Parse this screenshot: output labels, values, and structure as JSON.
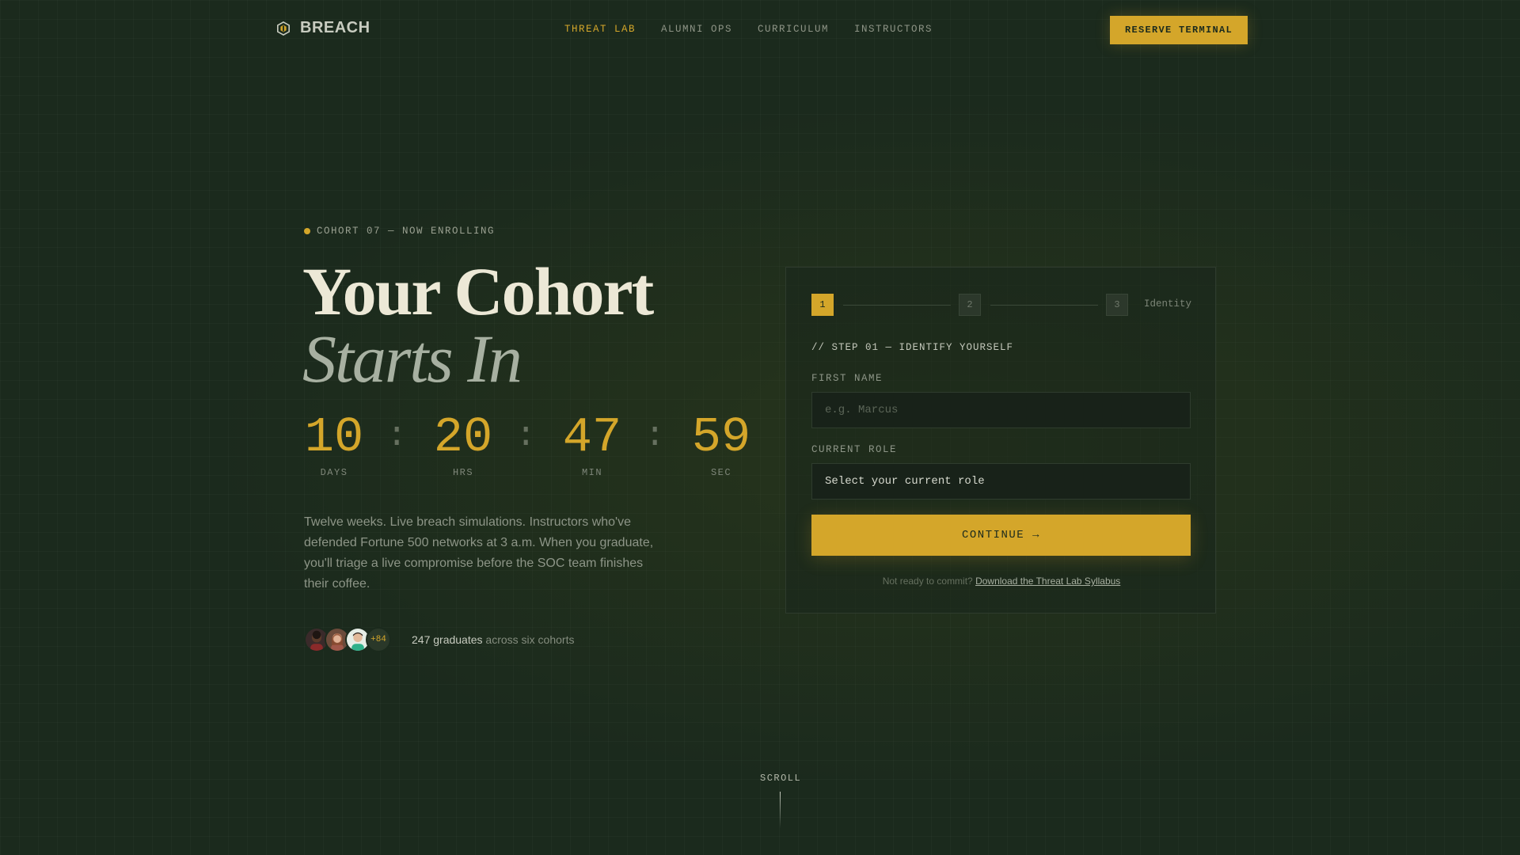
{
  "nav": {
    "brand": "BREACH",
    "links": [
      {
        "label": "THREAT LAB",
        "active": true
      },
      {
        "label": "ALUMNI OPS",
        "active": false
      },
      {
        "label": "CURRICULUM",
        "active": false
      },
      {
        "label": "INSTRUCTORS",
        "active": false
      }
    ],
    "cta": "RESERVE TERMINAL"
  },
  "hero": {
    "eyebrow": "COHORT 07 — NOW ENROLLING",
    "title_line1": "Your Cohort",
    "title_line2": "Starts In",
    "countdown": [
      {
        "value": "10",
        "label": "DAYS"
      },
      {
        "value": "20",
        "label": "HRS"
      },
      {
        "value": "47",
        "label": "MIN"
      },
      {
        "value": "59",
        "label": "SEC"
      }
    ],
    "separator": ":",
    "description": "Twelve weeks. Live breach simulations. Instructors who've defended Fortune 500 networks at 3 a.m. When you graduate, you'll triage a live compromise before the SOC team finishes their coffee.",
    "social": {
      "more_count": "+84",
      "graduates": "247 graduates",
      "suffix": " across six cohorts"
    }
  },
  "form": {
    "steps": [
      {
        "number": "1",
        "active": true
      },
      {
        "number": "2",
        "active": false
      },
      {
        "number": "3",
        "active": false
      }
    ],
    "step_caption": "Identity",
    "eyebrow": "// STEP 01 — IDENTIFY YOURSELF",
    "first_name_label": "FIRST NAME",
    "first_name_placeholder": "e.g. Marcus",
    "role_label": "CURRENT ROLE",
    "role_selected": "Select your current role",
    "submit": "CONTINUE →",
    "alt_prefix": "Not ready to commit? ",
    "alt_link": "Download the Threat Lab Syllabus"
  },
  "scroll_label": "SCROLL",
  "colors": {
    "background": "#1b2a1d",
    "accent": "#d4a62a",
    "heading": "#ece8d6",
    "muted": "#8d9587"
  },
  "icons": {
    "brand": "hexagon-shield-icon",
    "scroll": "scroll-line-indicator"
  }
}
